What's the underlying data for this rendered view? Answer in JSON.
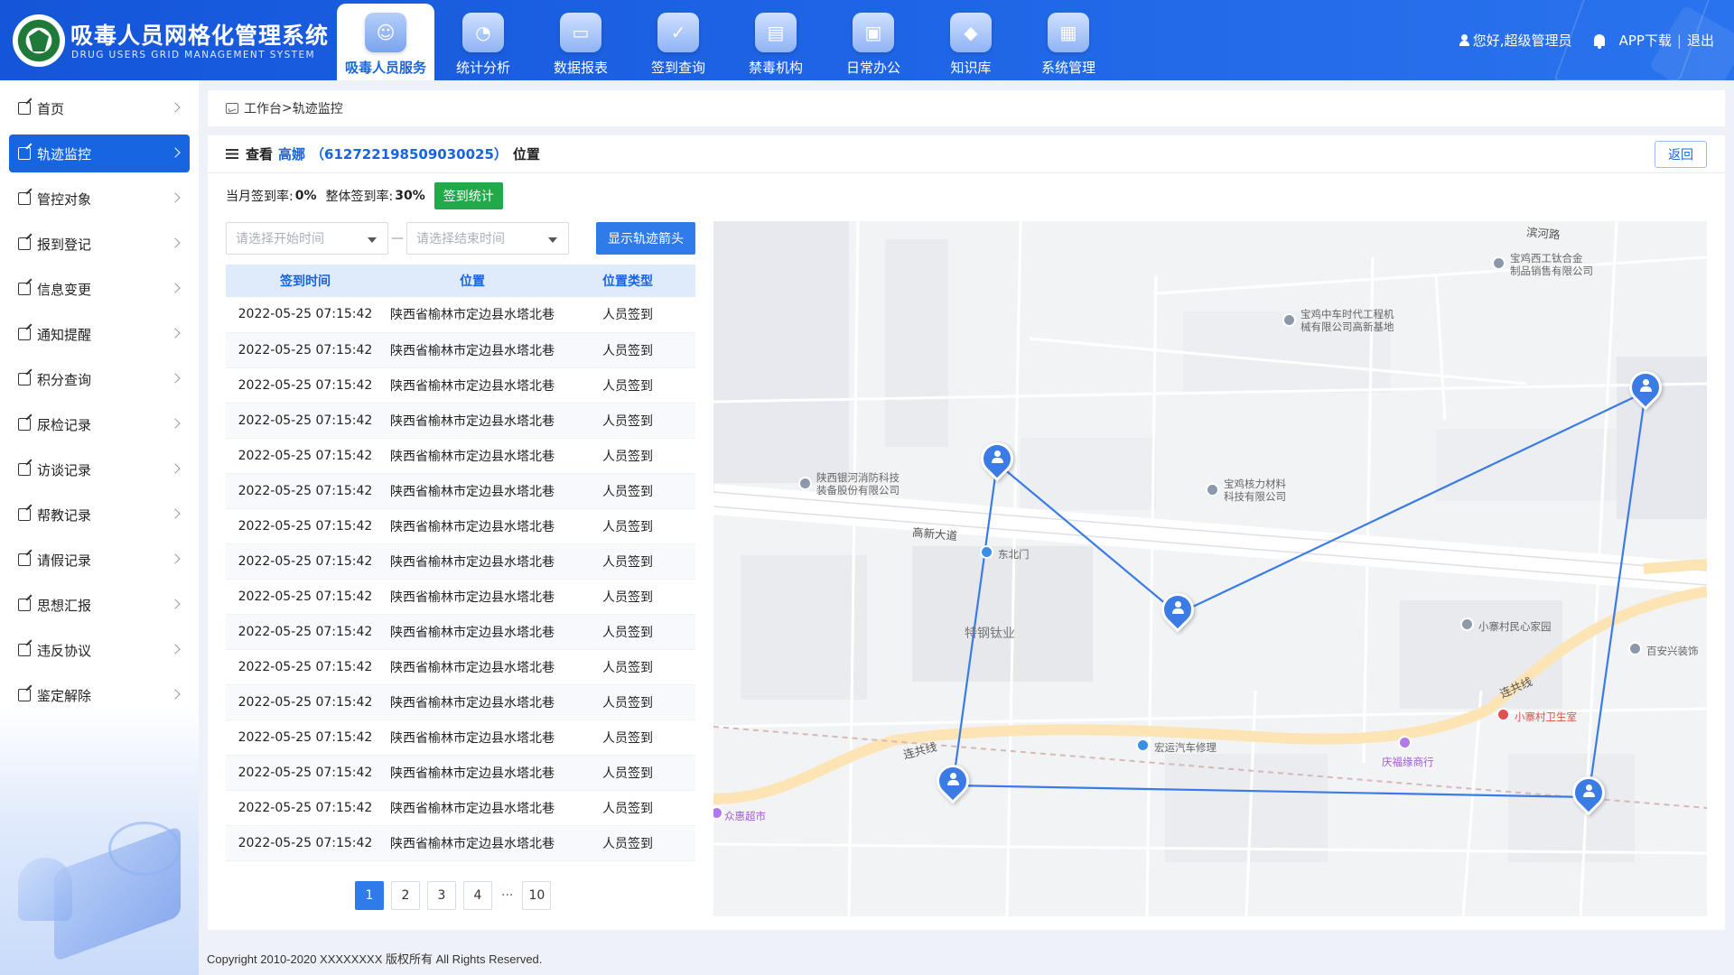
{
  "header": {
    "title": "吸毒人员网格化管理系统",
    "subtitle": "DRUG USERS GRID MANAGEMENT SYSTEM",
    "nav": [
      {
        "label": "吸毒人员服务",
        "icon": "user-service-icon",
        "active": true
      },
      {
        "label": "统计分析",
        "icon": "chart-analysis-icon",
        "active": false
      },
      {
        "label": "数据报表",
        "icon": "monitor-report-icon",
        "active": false
      },
      {
        "label": "签到查询",
        "icon": "checkin-calendar-icon",
        "active": false
      },
      {
        "label": "禁毒机构",
        "icon": "building-icon",
        "active": false
      },
      {
        "label": "日常办公",
        "icon": "briefcase-icon",
        "active": false
      },
      {
        "label": "知识库",
        "icon": "graduation-cap-icon",
        "active": false
      },
      {
        "label": "系统管理",
        "icon": "grid-apps-icon",
        "active": false
      }
    ],
    "greeting": "您好,超级管理员",
    "app_download": "APP下载",
    "logout": "退出"
  },
  "sidebar": {
    "items": [
      {
        "label": "首页",
        "active": false
      },
      {
        "label": "轨迹监控",
        "active": true
      },
      {
        "label": "管控对象",
        "active": false
      },
      {
        "label": "报到登记",
        "active": false
      },
      {
        "label": "信息变更",
        "active": false
      },
      {
        "label": "通知提醒",
        "active": false
      },
      {
        "label": "积分查询",
        "active": false
      },
      {
        "label": "尿检记录",
        "active": false
      },
      {
        "label": "访谈记录",
        "active": false
      },
      {
        "label": "帮教记录",
        "active": false
      },
      {
        "label": "请假记录",
        "active": false
      },
      {
        "label": "思想汇报",
        "active": false
      },
      {
        "label": "违反协议",
        "active": false
      },
      {
        "label": "鉴定解除",
        "active": false
      }
    ]
  },
  "breadcrumb": {
    "root": "工作台",
    "sep": ">",
    "current": "轨迹监控"
  },
  "panel": {
    "prefix": "查看",
    "person_name": "高娜",
    "person_id": "（612722198509030025）",
    "suffix": "位置",
    "back_label": "返回"
  },
  "rates": {
    "month_label": "当月签到率:",
    "month_value": "0%",
    "overall_label": "整体签到率:",
    "overall_value": "30%",
    "stat_button": "签到统计"
  },
  "filters": {
    "start_placeholder": "请选择开始时间",
    "dash": "—",
    "end_placeholder": "请选择结束时间",
    "arrow_button": "显示轨迹箭头"
  },
  "table": {
    "headers": [
      "签到时间",
      "位置",
      "位置类型"
    ],
    "rows": [
      [
        "2022-05-25 07:15:42",
        "陕西省榆林市定边县水塔北巷",
        "人员签到"
      ],
      [
        "2022-05-25 07:15:42",
        "陕西省榆林市定边县水塔北巷",
        "人员签到"
      ],
      [
        "2022-05-25 07:15:42",
        "陕西省榆林市定边县水塔北巷",
        "人员签到"
      ],
      [
        "2022-05-25 07:15:42",
        "陕西省榆林市定边县水塔北巷",
        "人员签到"
      ],
      [
        "2022-05-25 07:15:42",
        "陕西省榆林市定边县水塔北巷",
        "人员签到"
      ],
      [
        "2022-05-25 07:15:42",
        "陕西省榆林市定边县水塔北巷",
        "人员签到"
      ],
      [
        "2022-05-25 07:15:42",
        "陕西省榆林市定边县水塔北巷",
        "人员签到"
      ],
      [
        "2022-05-25 07:15:42",
        "陕西省榆林市定边县水塔北巷",
        "人员签到"
      ],
      [
        "2022-05-25 07:15:42",
        "陕西省榆林市定边县水塔北巷",
        "人员签到"
      ],
      [
        "2022-05-25 07:15:42",
        "陕西省榆林市定边县水塔北巷",
        "人员签到"
      ],
      [
        "2022-05-25 07:15:42",
        "陕西省榆林市定边县水塔北巷",
        "人员签到"
      ],
      [
        "2022-05-25 07:15:42",
        "陕西省榆林市定边县水塔北巷",
        "人员签到"
      ],
      [
        "2022-05-25 07:15:42",
        "陕西省榆林市定边县水塔北巷",
        "人员签到"
      ],
      [
        "2022-05-25 07:15:42",
        "陕西省榆林市定边县水塔北巷",
        "人员签到"
      ],
      [
        "2022-05-25 07:15:42",
        "陕西省榆林市定边县水塔北巷",
        "人员签到"
      ],
      [
        "2022-05-25 07:15:42",
        "陕西省榆林市定边县水塔北巷",
        "人员签到"
      ]
    ]
  },
  "pagination": {
    "pages": [
      "1",
      "2",
      "3",
      "4"
    ],
    "ellipsis": "···",
    "last": "10",
    "current": "1"
  },
  "map": {
    "labels": {
      "road1": "滨河路",
      "poi1": "宝鸡西工钛合金\n制品销售有限公司",
      "poi2": "宝鸡中车时代工程机\n械有限公司高新基地",
      "poi3": "陕西银河消防科技\n装备股份有限公司",
      "poi4": "宝鸡核力材料\n科技有限公司",
      "road2": "高新大道",
      "gate": "东北门",
      "area": "特钢钛业",
      "poi5": "小寨村民心家园",
      "poi6": "百安兴装饰",
      "road3": "连共线",
      "road4": "连共线",
      "clinic": "小寨村卫生室",
      "repair": "宏运汽车修理",
      "shop": "庆福缘商行",
      "market": "众惠超市"
    },
    "track_color": "#3a7be6"
  },
  "footer": {
    "copyright": "Copyright 2010-2020 XXXXXXXX 版权所有 All Rights Reserved."
  }
}
